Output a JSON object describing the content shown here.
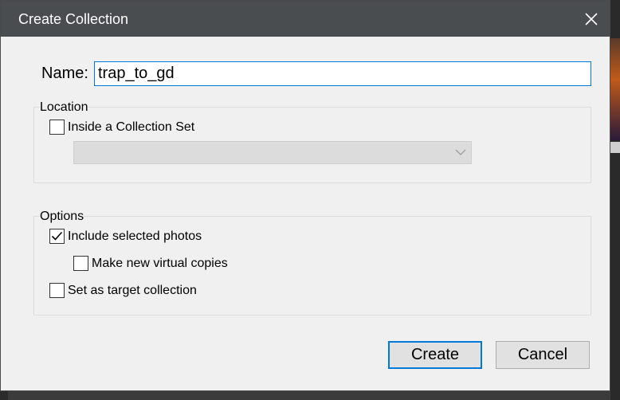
{
  "dialog": {
    "title": "Create Collection",
    "close_icon": "close-icon"
  },
  "name_field": {
    "label": "Name:",
    "value": "trap_to_gd"
  },
  "location": {
    "label": "Location",
    "inside_collection_set": {
      "label": "Inside a Collection Set",
      "checked": false
    },
    "collection_set_select": {
      "selected": "",
      "enabled": false
    }
  },
  "options": {
    "label": "Options",
    "include_selected_photos": {
      "label": "Include selected photos",
      "checked": true
    },
    "make_virtual_copies": {
      "label": "Make new virtual copies",
      "checked": false
    },
    "set_as_target": {
      "label": "Set as target collection",
      "checked": false
    }
  },
  "buttons": {
    "create": "Create",
    "cancel": "Cancel"
  },
  "colors": {
    "titlebar": "#4a4d50",
    "focus_accent": "#0078d7",
    "dialog_bg": "#f0f0f0"
  }
}
